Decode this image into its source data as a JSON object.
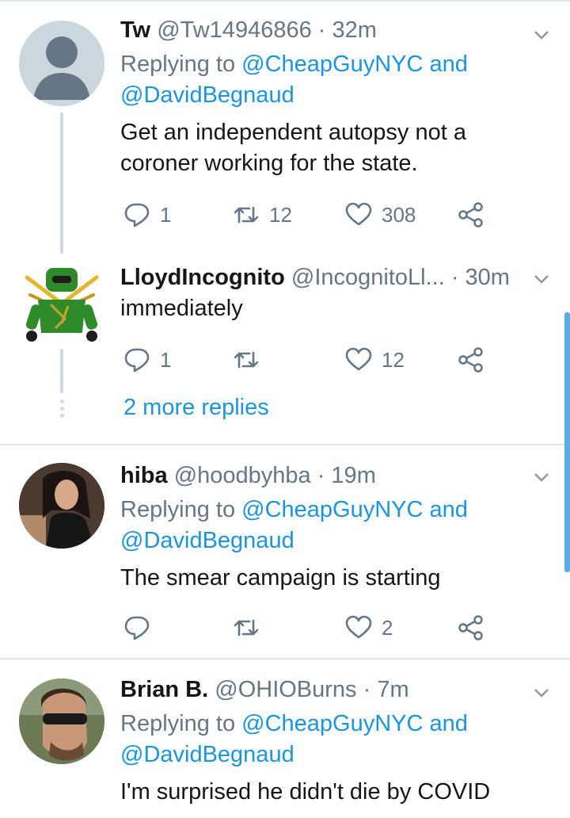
{
  "tweets": [
    {
      "name": "Tw",
      "handle": "@Tw14946866",
      "time": "· 32m",
      "replying_prefix": "Replying to",
      "replying_1": "@CheapGuyNYC",
      "replying_and": "and",
      "replying_2": "@DavidBegnaud",
      "text_line1": "Get an independent autopsy not a",
      "text_line2": "coroner working for the state.",
      "replies": "1",
      "retweets": "12",
      "likes": "308"
    },
    {
      "name": "LloydIncognito",
      "handle": "@IncognitoLl...",
      "time": "· 30m",
      "text_line1": "immediately",
      "replies": "1",
      "retweets": "",
      "likes": "12"
    },
    {
      "name": "hiba",
      "handle": "@hoodbyhba",
      "time": "· 19m",
      "replying_prefix": "Replying to",
      "replying_1": "@CheapGuyNYC",
      "replying_and": "and",
      "replying_2": "@DavidBegnaud",
      "text_line1": "The smear campaign is starting",
      "replies": "",
      "retweets": "",
      "likes": "2"
    },
    {
      "name": "Brian B.",
      "handle": "@OHIOBurns",
      "time": "· 7m",
      "replying_prefix": "Replying to",
      "replying_1": "@CheapGuyNYC",
      "replying_and": "and",
      "replying_2": "@DavidBegnaud",
      "text_line1": "I'm surprised he didn't die by COVID"
    }
  ],
  "more_replies": "2 more replies",
  "icons": {
    "reply": "reply-icon",
    "retweet": "retweet-icon",
    "like": "heart-icon",
    "share": "share-icon",
    "caret": "chevron-down-icon"
  },
  "colors": {
    "link": "#1b95e0",
    "secondary": "#657786",
    "divider": "#e1e8ed"
  }
}
